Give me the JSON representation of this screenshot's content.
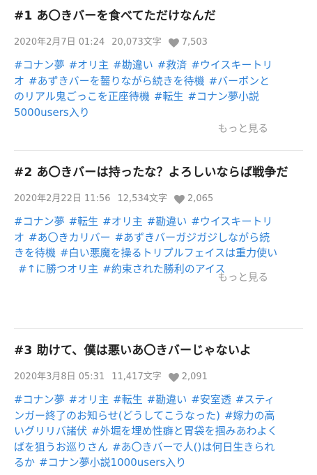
{
  "works": [
    {
      "title": "#1 あ〇きバーを食べてただけなんだ",
      "date": "2020年2月7日 01:24",
      "chars": "20,073文字",
      "likes": "7,503",
      "tags": [
        "#コナン夢",
        "#オリ主",
        "#勘違い",
        "#救済",
        "#ウイスキートリオ",
        "#あずきバーを齧りながら続きを待機",
        "#バーボンとのリアル鬼ごっこを正座待機",
        "#転生",
        "#コナン夢小説5000users入り"
      ],
      "more_label": "もっと見る"
    },
    {
      "title": "#2 あ〇きバーは持ったな？よろしいならば戦争だ",
      "date": "2020年2月22日 11:56",
      "chars": "12,534文字",
      "likes": "2,065",
      "tags": [
        "#コナン夢",
        "#転生",
        "#オリ主",
        "#勘違い",
        "#ウイスキートリオ",
        "#あ〇きカリバー",
        "#あずきバーガジガジしながら続きを待機",
        "#白い悪魔を操るトリプルフェイスは重力使い",
        "#↑に勝つオリ主",
        "#約束された勝利のアイス"
      ],
      "more_label": "もっと見る"
    },
    {
      "title": "#3 助けて、僕は悪いあ〇きバーじゃないよ",
      "date": "2020年3月8日 05:31",
      "chars": "11,417文字",
      "likes": "2,091",
      "tags": [
        "#コナン夢",
        "#オリ主",
        "#転生",
        "#勘違い",
        "#安室透",
        "#スティンガー終了のお知らせ(どうしてこうなった)",
        "#嫁力の高いグリリバ諸伏",
        "#外堀を埋め性癖と胃袋を掴みあわよくばを狙うお巡りさん",
        "#あ〇きバーで人()は何日生きられるか",
        "#コナン夢小説1000users入り"
      ]
    }
  ]
}
